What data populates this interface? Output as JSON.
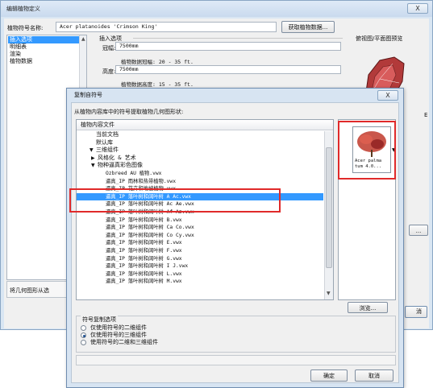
{
  "outer_dialog": {
    "title": "编辑植物定义",
    "close_glyph": "X",
    "symbol_name_label": "植物符号名称:",
    "symbol_name_value": "Acer platanoides 'Crimson King'",
    "get_plant_data_button": "获取植物数据...",
    "left_list": [
      "插入选项",
      "明细表",
      "渲染",
      "植物数据"
    ],
    "left_list_selected": 0,
    "insert_options_header": "插入选项",
    "canopy_label": "冠幅:",
    "canopy_value": "7500mm",
    "canopy_data": "植物数据冠幅: 20 - 35 ft.",
    "height_label": "高度:",
    "height_value": "7500mm",
    "height_data": "植物数据高度: 15 - 35 ft.",
    "preview_header": "俯视图/平面图预览",
    "side_fragment": "E",
    "hidden_button": "...",
    "bottom_left_label": "将几何图形从选",
    "cancel_button_partial": "消"
  },
  "inner_dialog": {
    "title": "复制自符号",
    "close_glyph": "X",
    "instruction": "从植物内容库中的符号提取植物几何图形状:",
    "tree_header": "植物内容文件",
    "tree_items": [
      {
        "text": "当前文档",
        "level": 1,
        "arrow": ""
      },
      {
        "text": "默认库",
        "level": 1,
        "arrow": ""
      },
      {
        "text": "三维组件",
        "level": 1,
        "arrow": "▼"
      },
      {
        "text": "风格化 & 艺术",
        "level": 2,
        "arrow": "▶"
      },
      {
        "text": "物种逼真彩色图像",
        "level": 2,
        "arrow": "▼"
      },
      {
        "text": "Ozbreed AU 植物.vwx",
        "level": 3,
        "arrow": ""
      },
      {
        "text": "逼真_IP 雨林和热带植物.vwx",
        "level": 3,
        "arrow": ""
      },
      {
        "text": "逼真_IP 花卉和地被植物.vwx",
        "level": 3,
        "arrow": ""
      },
      {
        "text": "逼真_IP 落叶树和阔叶树 A Ac.vwx",
        "level": 3,
        "arrow": ""
      },
      {
        "text": "逼真_IP 落叶树和阔叶树 Ac Ae.vwx",
        "level": 3,
        "arrow": ""
      },
      {
        "text": "逼真_IP 落叶树和阔叶树 Af Az.vwx",
        "level": 3,
        "arrow": ""
      },
      {
        "text": "逼真_IP 落叶树和阔叶树 B.vwx",
        "level": 3,
        "arrow": ""
      },
      {
        "text": "逼真_IP 落叶树和阔叶树 Ca Co.vwx",
        "level": 3,
        "arrow": ""
      },
      {
        "text": "逼真_IP 落叶树和阔叶树 Co Cy.vwx",
        "level": 3,
        "arrow": ""
      },
      {
        "text": "逼真_IP 落叶树和阔叶树 E.vwx",
        "level": 3,
        "arrow": ""
      },
      {
        "text": "逼真_IP 落叶树和阔叶树 F.vwx",
        "level": 3,
        "arrow": ""
      },
      {
        "text": "逼真_IP 落叶树和阔叶树 G.vwx",
        "level": 3,
        "arrow": ""
      },
      {
        "text": "逼真_IP 落叶树和阔叶树 I J.vwx",
        "level": 3,
        "arrow": ""
      },
      {
        "text": "逼真_IP 落叶树和阔叶树 L.vwx",
        "level": 3,
        "arrow": ""
      },
      {
        "text": "逼真_IP 落叶树和阔叶树 M.vwx",
        "level": 3,
        "arrow": ""
      }
    ],
    "selected_index": 8,
    "thumbnail_label_1": "Acer palma",
    "thumbnail_label_2": "tum 4.0...",
    "browse_button": "浏览...",
    "copy_options_title": "符号复制选项",
    "radio_options": [
      "仅使用符号的二维组件",
      "仅使用符号的三维组件",
      "使用符号的二维和三维组件"
    ],
    "radio_selected": 1,
    "ok_button": "确定",
    "cancel_button": "取消",
    "highlight_color": "#3399ff",
    "annotation_color": "#e02a2a"
  }
}
